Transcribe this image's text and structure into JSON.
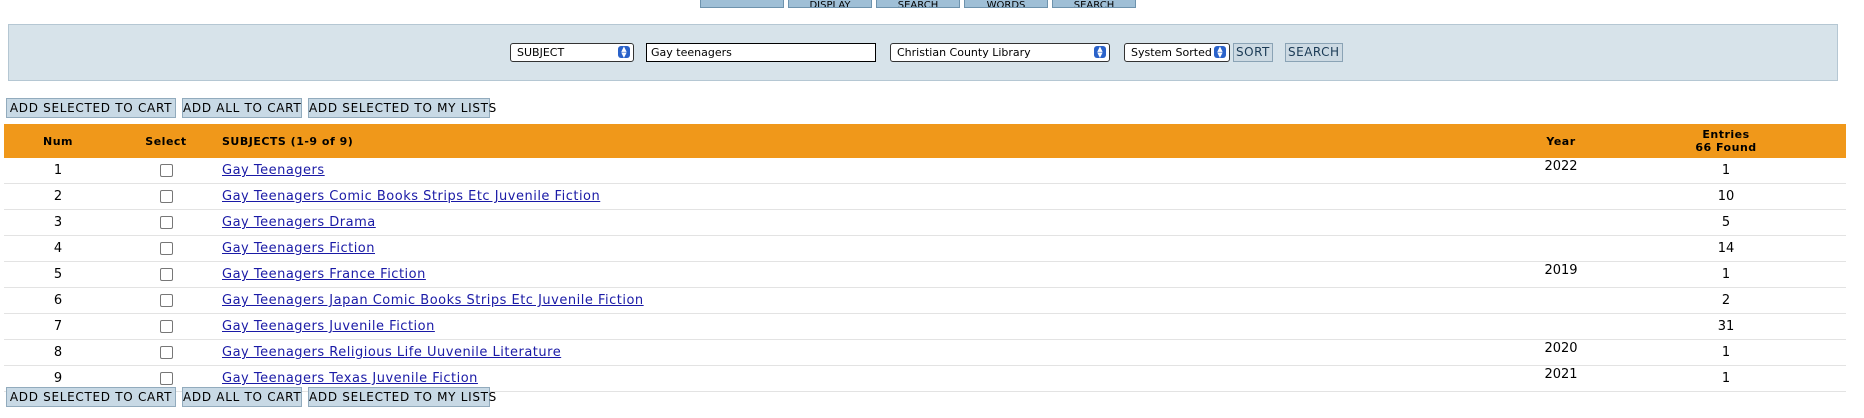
{
  "top_tabs": [
    "",
    "DISPLAY",
    "SEARCH",
    "WORDS",
    "SEARCH"
  ],
  "search_bar": {
    "type_select": "SUBJECT",
    "query": "Gay teenagers",
    "library_select": "Christian County Library",
    "sort_select": "System Sorted",
    "sort_button": "SORT",
    "search_button": "SEARCH"
  },
  "actions": {
    "add_selected_cart": "ADD SELECTED TO CART",
    "add_all_cart": "ADD ALL TO CART",
    "add_selected_lists": "ADD SELECTED TO MY LISTS"
  },
  "table": {
    "headers": {
      "num": "Num",
      "select": "Select",
      "subjects": "SUBJECTS (1-9 of 9)",
      "year": "Year",
      "entries_line1": "Entries",
      "entries_line2": "66 Found"
    },
    "rows": [
      {
        "num": "1",
        "subject": "Gay Teenagers",
        "year": "2022",
        "entries": "1"
      },
      {
        "num": "2",
        "subject": "Gay Teenagers Comic Books Strips Etc Juvenile Fiction",
        "year": "",
        "entries": "10"
      },
      {
        "num": "3",
        "subject": "Gay Teenagers Drama",
        "year": "",
        "entries": "5"
      },
      {
        "num": "4",
        "subject": "Gay Teenagers Fiction",
        "year": "",
        "entries": "14"
      },
      {
        "num": "5",
        "subject": "Gay Teenagers France Fiction",
        "year": "2019",
        "entries": "1"
      },
      {
        "num": "6",
        "subject": "Gay Teenagers Japan Comic Books Strips Etc Juvenile Fiction",
        "year": "",
        "entries": "2"
      },
      {
        "num": "7",
        "subject": "Gay Teenagers Juvenile Fiction",
        "year": "",
        "entries": "31"
      },
      {
        "num": "8",
        "subject": "Gay Teenagers Religious Life Uuvenile Literature",
        "year": "2020",
        "entries": "1"
      },
      {
        "num": "9",
        "subject": "Gay Teenagers Texas Juvenile Fiction",
        "year": "2021",
        "entries": "1"
      }
    ]
  },
  "colors": {
    "header_bg": "#f0981a",
    "search_panel_bg": "#d7e3ea",
    "button_bg": "#c8d9e5",
    "link": "#1a1aa6"
  }
}
